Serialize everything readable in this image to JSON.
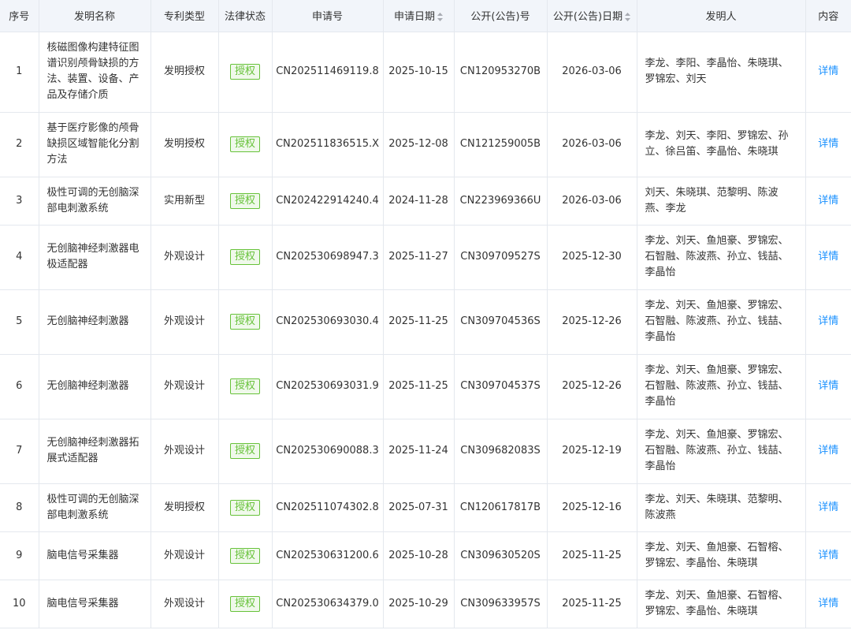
{
  "columns": {
    "index": "序号",
    "name": "发明名称",
    "type": "专利类型",
    "status": "法律状态",
    "app_no": "申请号",
    "app_date": "申请日期",
    "pub_no": "公开(公告)号",
    "pub_date": "公开(公告)日期",
    "inventors": "发明人",
    "content": "内容"
  },
  "colors": {
    "header_bg": "#f2f5fa",
    "badge_green": "#67c23a",
    "link_blue": "#1890ff"
  },
  "rows": [
    {
      "index": "1",
      "name": "核磁图像构建特征图谱识别颅骨缺损的方法、装置、设备、产品及存储介质",
      "type": "发明授权",
      "status": "授权",
      "app_no": "CN202511469119.8",
      "app_date": "2025-10-15",
      "pub_no": "CN120953270B",
      "pub_date": "2026-03-06",
      "inventors": "李龙、李阳、李晶怡、朱晓琪、罗锦宏、刘天",
      "content": "详情"
    },
    {
      "index": "2",
      "name": "基于医疗影像的颅骨缺损区域智能化分割方法",
      "type": "发明授权",
      "status": "授权",
      "app_no": "CN202511836515.X",
      "app_date": "2025-12-08",
      "pub_no": "CN121259005B",
      "pub_date": "2026-03-06",
      "inventors": "李龙、刘天、李阳、罗锦宏、孙立、徐吕笛、李晶怡、朱晓琪",
      "content": "详情"
    },
    {
      "index": "3",
      "name": "极性可调的无创脑深部电刺激系统",
      "type": "实用新型",
      "status": "授权",
      "app_no": "CN202422914240.4",
      "app_date": "2024-11-28",
      "pub_no": "CN223969366U",
      "pub_date": "2026-03-06",
      "inventors": "刘天、朱晓琪、范黎明、陈波燕、李龙",
      "content": "详情"
    },
    {
      "index": "4",
      "name": "无创脑神经刺激器电极适配器",
      "type": "外观设计",
      "status": "授权",
      "app_no": "CN202530698947.3",
      "app_date": "2025-11-27",
      "pub_no": "CN309709527S",
      "pub_date": "2025-12-30",
      "inventors": "李龙、刘天、鱼旭豪、罗锦宏、石智融、陈波燕、孙立、钱喆、李晶怡",
      "content": "详情"
    },
    {
      "index": "5",
      "name": "无创脑神经刺激器",
      "type": "外观设计",
      "status": "授权",
      "app_no": "CN202530693030.4",
      "app_date": "2025-11-25",
      "pub_no": "CN309704536S",
      "pub_date": "2025-12-26",
      "inventors": "李龙、刘天、鱼旭豪、罗锦宏、石智融、陈波燕、孙立、钱喆、李晶怡",
      "content": "详情"
    },
    {
      "index": "6",
      "name": "无创脑神经刺激器",
      "type": "外观设计",
      "status": "授权",
      "app_no": "CN202530693031.9",
      "app_date": "2025-11-25",
      "pub_no": "CN309704537S",
      "pub_date": "2025-12-26",
      "inventors": "李龙、刘天、鱼旭豪、罗锦宏、石智融、陈波燕、孙立、钱喆、李晶怡",
      "content": "详情"
    },
    {
      "index": "7",
      "name": "无创脑神经刺激器拓展式适配器",
      "type": "外观设计",
      "status": "授权",
      "app_no": "CN202530690088.3",
      "app_date": "2025-11-24",
      "pub_no": "CN309682083S",
      "pub_date": "2025-12-19",
      "inventors": "李龙、刘天、鱼旭豪、罗锦宏、石智融、陈波燕、孙立、钱喆、李晶怡",
      "content": "详情"
    },
    {
      "index": "8",
      "name": "极性可调的无创脑深部电刺激系统",
      "type": "发明授权",
      "status": "授权",
      "app_no": "CN202511074302.8",
      "app_date": "2025-07-31",
      "pub_no": "CN120617817B",
      "pub_date": "2025-12-16",
      "inventors": "李龙、刘天、朱晓琪、范黎明、陈波燕",
      "content": "详情"
    },
    {
      "index": "9",
      "name": "脑电信号采集器",
      "type": "外观设计",
      "status": "授权",
      "app_no": "CN202530631200.6",
      "app_date": "2025-10-28",
      "pub_no": "CN309630520S",
      "pub_date": "2025-11-25",
      "inventors": "李龙、刘天、鱼旭豪、石智榕、罗锦宏、李晶怡、朱晓琪",
      "content": "详情"
    },
    {
      "index": "10",
      "name": "脑电信号采集器",
      "type": "外观设计",
      "status": "授权",
      "app_no": "CN202530634379.0",
      "app_date": "2025-10-29",
      "pub_no": "CN309633957S",
      "pub_date": "2025-11-25",
      "inventors": "李龙、刘天、鱼旭豪、石智榕、罗锦宏、李晶怡、朱晓琪",
      "content": "详情"
    }
  ]
}
